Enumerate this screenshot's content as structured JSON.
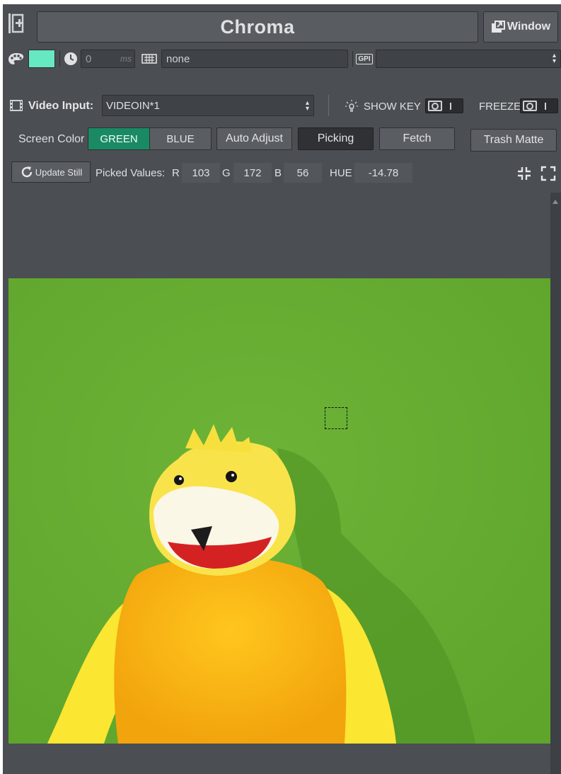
{
  "header": {
    "title": "Chroma",
    "window_button_label": "Window"
  },
  "toolbar": {
    "key_color": "#66e8c3",
    "delay_value": "0",
    "delay_unit": "ms",
    "pattern_value": "none",
    "gpi_badge": "GPI",
    "gpi_value": ""
  },
  "video_input": {
    "label": "Video Input:",
    "value": "VIDEOIN*1",
    "show_key_label": "SHOW KEY",
    "freeze_label": "FREEZE"
  },
  "screen_color": {
    "label": "Screen Color",
    "options": [
      "GREEN",
      "BLUE"
    ],
    "selected": "GREEN",
    "auto_adjust_label": "Auto Adjust",
    "picking_label": "Picking",
    "fetch_label": "Fetch",
    "trash_matte_label": "Trash Matte"
  },
  "picked": {
    "update_still_label": "Update Still",
    "label": "Picked Values:",
    "r_label": "R",
    "r": "103",
    "g_label": "G",
    "g": "172",
    "b_label": "B",
    "b": "56",
    "hue_label": "HUE",
    "hue": "-14.78"
  },
  "colors": {
    "panel_bg": "#4b4e52",
    "green_selected": "#1a8a64",
    "green_screen": "#66ad31"
  },
  "icons": [
    "dock-add-icon",
    "window-popout-icon",
    "palette-icon",
    "clock-icon",
    "keyboard-icon",
    "gpi-icon",
    "film-icon",
    "bulb-icon",
    "refresh-icon",
    "collapse-icon",
    "expand-icon",
    "scroll-up-arrow-icon"
  ]
}
